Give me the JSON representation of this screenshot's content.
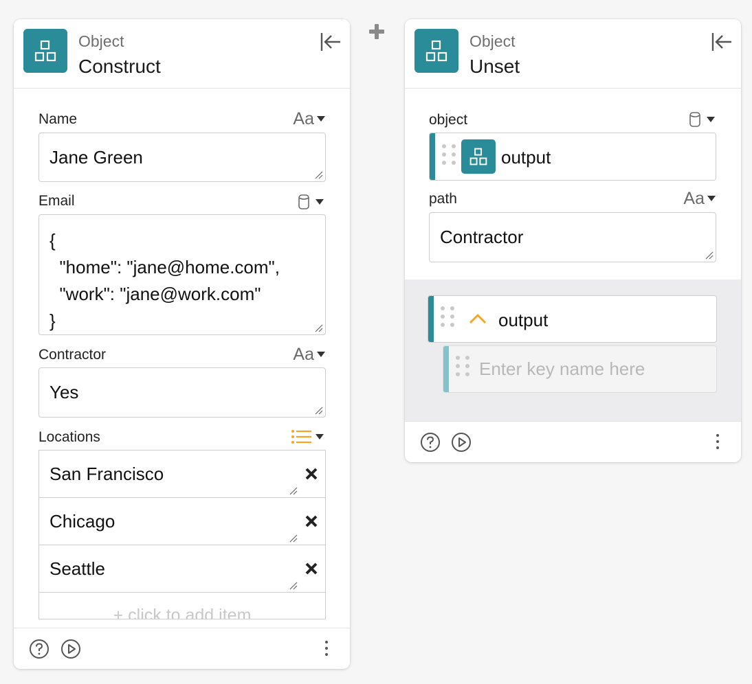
{
  "between_cards": {
    "add_icon": "plus-icon"
  },
  "construct_card": {
    "category": "Object",
    "title": "Construct",
    "icon": "object-blocks-icon",
    "collapse_icon": "collapse-left-icon",
    "fields": {
      "name": {
        "label": "Name",
        "type_glyph": "Aa",
        "value": "Jane Green"
      },
      "email": {
        "label": "Email",
        "type_icon": "database-icon",
        "value_lines": [
          "{",
          "  \"home\": \"jane@home.com\",",
          "  \"work\": \"jane@work.com\"",
          "}"
        ]
      },
      "contractor": {
        "label": "Contractor",
        "type_glyph": "Aa",
        "value": "Yes"
      },
      "locations": {
        "label": "Locations",
        "type_icon": "list-icon",
        "items": [
          "San Francisco",
          "Chicago",
          "Seattle"
        ],
        "add_item_text": "+ click to add item"
      }
    },
    "footer": {
      "help_icon": "help-icon",
      "run_icon": "play-icon",
      "more_icon": "more-vertical-icon"
    }
  },
  "unset_card": {
    "category": "Object",
    "title": "Unset",
    "icon": "object-blocks-icon",
    "collapse_icon": "collapse-left-icon",
    "fields": {
      "object": {
        "label": "object",
        "type_icon": "database-icon",
        "ref_value": "output"
      },
      "path": {
        "label": "path",
        "type_glyph": "Aa",
        "value": "Contractor"
      }
    },
    "output": {
      "label": "output",
      "expand_icon": "chevron-up-icon",
      "key_placeholder": "Enter key name here"
    },
    "footer": {
      "help_icon": "help-icon",
      "run_icon": "play-icon",
      "more_icon": "more-vertical-icon"
    }
  },
  "colors": {
    "accent": "#2a8b99",
    "accent_light": "#86c0ca",
    "list_icon": "#f5a623",
    "chevron": "#f5a623"
  }
}
